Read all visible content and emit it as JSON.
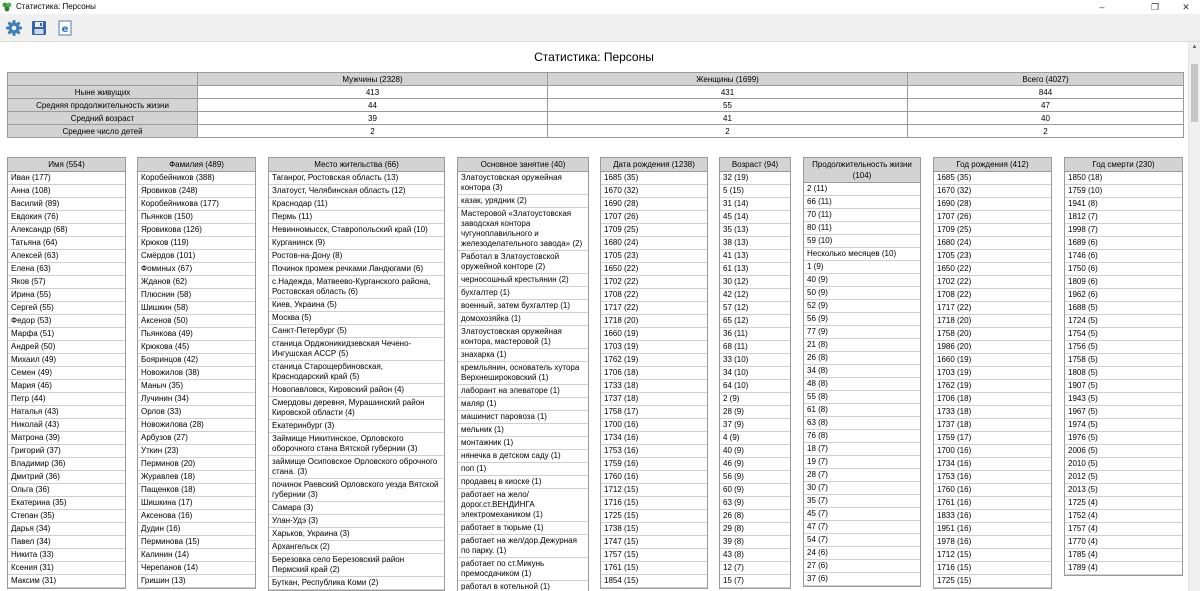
{
  "window": {
    "title": "Статистика: Персоны"
  },
  "report": {
    "title": "Статистика: Персоны"
  },
  "summary": {
    "headers": [
      "Мужчины (2328)",
      "Женщины (1699)",
      "Всего (4027)"
    ],
    "rows": [
      {
        "label": "Ныне живущих",
        "values": [
          "413",
          "431",
          "844"
        ]
      },
      {
        "label": "Средняя продолжительность жизни",
        "values": [
          "44",
          "55",
          "47"
        ]
      },
      {
        "label": "Средний возраст",
        "values": [
          "39",
          "41",
          "40"
        ]
      },
      {
        "label": "Среднее число детей",
        "values": [
          "2",
          "2",
          "2"
        ]
      }
    ]
  },
  "columns": [
    {
      "header": "Имя (554)",
      "items": [
        "Иван (177)",
        "Анна (108)",
        "Василий (89)",
        "Евдокия (76)",
        "Александр (68)",
        "Татьяна (64)",
        "Алексей (63)",
        "Елена (63)",
        "Яков (57)",
        "Ирина (55)",
        "Сергей (55)",
        "Федор (53)",
        "Марфа (51)",
        "Андрей (50)",
        "Михаил (49)",
        "Семен (49)",
        "Мария (46)",
        "Петр (44)",
        "Наталья (43)",
        "Николай (43)",
        "Матрона (39)",
        "Григорий (37)",
        "Владимир (36)",
        "Дмитрий (36)",
        "Ольга (36)",
        "Екатерина (35)",
        "Степан (35)",
        "Дарья (34)",
        "Павел (34)",
        "Никита (33)",
        "Ксения (31)",
        "Максим (31)"
      ]
    },
    {
      "header": "Фамилия (489)",
      "items": [
        "Коробейников (388)",
        "Яровиков (248)",
        "Коробейникова (177)",
        "Пьянков (150)",
        "Яровикова (126)",
        "Крюков (119)",
        "Смёрдов (101)",
        "Фоминых (67)",
        "Жданов (62)",
        "Плюснин (58)",
        "Шишкин (58)",
        "Аксенов (50)",
        "Пьянкова (49)",
        "Крюкова (45)",
        "Бояринцов (42)",
        "Новожилов (38)",
        "Маныч (35)",
        "Лучинин (34)",
        "Орлов (33)",
        "Новожилова (28)",
        "Арбузов (27)",
        "Уткин (23)",
        "Перминов (20)",
        "Журавлев (18)",
        "Пащенков (18)",
        "Шишкина (17)",
        "Аксенова (16)",
        "Дудин (16)",
        "Перминова (15)",
        "Калинин (14)",
        "Черепанов (14)",
        "Гришин (13)"
      ]
    },
    {
      "header": "Место жительства (66)",
      "items": [
        "Таганрог, Ростовская область (13)",
        "Златоуст, Челябинская область (12)",
        "Краснодар (11)",
        "Пермь (11)",
        "Невинномысск, Ставропольский край (10)",
        "Курганинск (9)",
        "Ростов-на-Дону (8)",
        "Починок промеж речками Ландюгами (6)",
        "с.Надежда, Матвеево-Курганского района, Ростовская область (6)",
        "Киев, Украина (5)",
        "Москва (5)",
        "Санкт-Петербург (5)",
        "станица Орджоникидзевская Чечено-Ингушская АССР (5)",
        "станица Старощербиновская, Краснодарский край (5)",
        "Новопавловск, Кировский район (4)",
        "Смердовы деревня, Мурашинский район Кировской области (4)",
        "Екатеринбург (3)",
        "Займище Никитинское, Орловского оборочного стана Вятской губернии (3)",
        "займище Осиповское Орловского оброчного стана. (3)",
        "починок Раевский Орловского уезда Вятской губернии (3)",
        "Самара (3)",
        "Улан-Удэ (3)",
        "Харьков, Украина (3)",
        "Архангельск (2)",
        "Березовка село Березовский район Пермский край (2)",
        "Буткан, Республика Коми (2)"
      ]
    },
    {
      "header": "Основное занятие (40)",
      "items": [
        "Златоустовская оружейная контора (3)",
        "казак, урядник (2)",
        "Мастеровой «Златоустовская заводская контора чугуноплавильного и железоделательного завода» (2)",
        "Работал в Златоустовской оружейной конторе (2)",
        "черносошный крестьянин (2)",
        "бухгалтер (1)",
        "военный, затем бухгалтер (1)",
        "домохозяйка (1)",
        "Златоустовская оружейная контора, мастеровой (1)",
        "знахарка (1)",
        "кремльянин, основатель хутора Верхнешироковский (1)",
        "лаборант на элеваторе (1)",
        "маляр (1)",
        "машинист паровоза (1)",
        "мельник (1)",
        "монтажник (1)",
        "нянечка в детском саду (1)",
        "поп (1)",
        "продавец в киоске (1)",
        "работает на жело/дорог.ст.ВЕНДИНГА электромехаником (1)",
        "работает в тюрьме (1)",
        "работает на жел/дор.Дежурная по парку. (1)",
        "работает по ст.Микунь премосдачиком (1)",
        "работал в котельной (1)"
      ]
    },
    {
      "header": "Дата рождения (1238)",
      "items": [
        "1685 (35)",
        "1670 (32)",
        "1690 (28)",
        "1707 (26)",
        "1709 (25)",
        "1680 (24)",
        "1705 (23)",
        "1650 (22)",
        "1702 (22)",
        "1708 (22)",
        "1717 (22)",
        "1718 (20)",
        "1660 (19)",
        "1703 (19)",
        "1762 (19)",
        "1706 (18)",
        "1733 (18)",
        "1737 (18)",
        "1758 (17)",
        "1700 (16)",
        "1734 (16)",
        "1753 (16)",
        "1759 (16)",
        "1760 (16)",
        "1712 (15)",
        "1716 (15)",
        "1725 (15)",
        "1738 (15)",
        "1747 (15)",
        "1757 (15)",
        "1761 (15)",
        "1854 (15)"
      ]
    },
    {
      "header": "Возраст (94)",
      "items": [
        "32 (19)",
        "5 (15)",
        "31 (14)",
        "45 (14)",
        "35 (13)",
        "38 (13)",
        "41 (13)",
        "61 (13)",
        "30 (12)",
        "42 (12)",
        "57 (12)",
        "65 (12)",
        "36 (11)",
        "68 (11)",
        "33 (10)",
        "34 (10)",
        "64 (10)",
        "2 (9)",
        "28 (9)",
        "37 (9)",
        "4 (9)",
        "40 (9)",
        "46 (9)",
        "56 (9)",
        "60 (9)",
        "63 (9)",
        "26 (8)",
        "29 (8)",
        "39 (8)",
        "43 (8)",
        "12 (7)",
        "15 (7)"
      ]
    },
    {
      "header": "Продолжительность жизни (104)",
      "items": [
        "2 (11)",
        "66 (11)",
        "70 (11)",
        "80 (11)",
        "59 (10)",
        "Несколько месяцев (10)",
        "1 (9)",
        "40 (9)",
        "50 (9)",
        "52 (9)",
        "56 (9)",
        "77 (9)",
        "21 (8)",
        "26 (8)",
        "34 (8)",
        "48 (8)",
        "55 (8)",
        "61 (8)",
        "63 (8)",
        "76 (8)",
        "18 (7)",
        "19 (7)",
        "28 (7)",
        "30 (7)",
        "35 (7)",
        "45 (7)",
        "47 (7)",
        "54 (7)",
        "24 (6)",
        "27 (6)",
        "37 (6)"
      ]
    },
    {
      "header": "Год рождения (412)",
      "items": [
        "1685 (35)",
        "1670 (32)",
        "1690 (28)",
        "1707 (26)",
        "1709 (25)",
        "1680 (24)",
        "1705 (23)",
        "1650 (22)",
        "1702 (22)",
        "1708 (22)",
        "1717 (22)",
        "1718 (20)",
        "1758 (20)",
        "1986 (20)",
        "1660 (19)",
        "1703 (19)",
        "1762 (19)",
        "1706 (18)",
        "1733 (18)",
        "1737 (18)",
        "1759 (17)",
        "1700 (16)",
        "1734 (16)",
        "1753 (16)",
        "1760 (16)",
        "1761 (16)",
        "1833 (16)",
        "1951 (16)",
        "1978 (16)",
        "1712 (15)",
        "1716 (15)",
        "1725 (15)"
      ]
    },
    {
      "header": "Год смерти (230)",
      "items": [
        "1850 (18)",
        "1759 (10)",
        "1941 (8)",
        "1812 (7)",
        "1998 (7)",
        "1689 (6)",
        "1746 (6)",
        "1750 (6)",
        "1809 (6)",
        "1962 (6)",
        "1688 (5)",
        "1724 (5)",
        "1754 (5)",
        "1756 (5)",
        "1758 (5)",
        "1808 (5)",
        "1907 (5)",
        "1943 (5)",
        "1967 (5)",
        "1974 (5)",
        "1976 (5)",
        "2006 (5)",
        "2010 (5)",
        "2012 (5)",
        "2013 (5)",
        "1725 (4)",
        "1752 (4)",
        "1757 (4)",
        "1770 (4)",
        "1785 (4)",
        "1789 (4)"
      ]
    }
  ]
}
